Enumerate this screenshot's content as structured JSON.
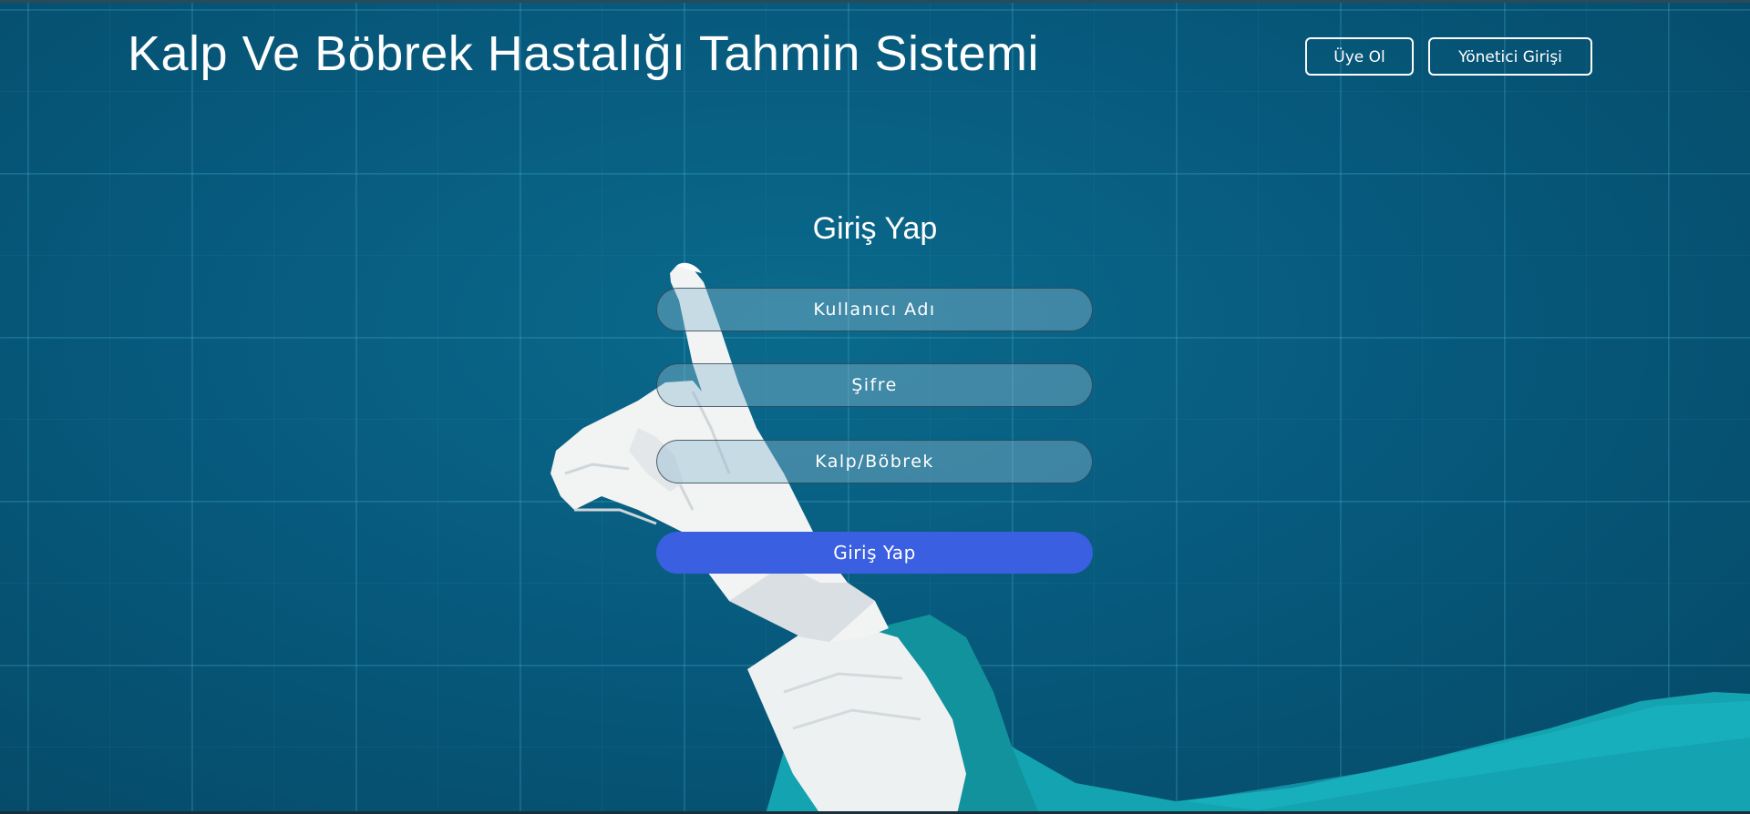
{
  "header": {
    "title": "Kalp Ve Böbrek Hastalığı Tahmin Sistemi",
    "register_label": "Üye Ol",
    "admin_login_label": "Yönetici Girişi"
  },
  "login_form": {
    "title": "Giriş Yap",
    "username_placeholder": "Kullanıcı Adı",
    "password_placeholder": "Şifre",
    "type_placeholder": "Kalp/Böbrek",
    "submit_label": "Giriş Yap"
  },
  "colors": {
    "background": "#075a7d",
    "accent_button": "#3a5fe0",
    "text": "#ffffff"
  }
}
